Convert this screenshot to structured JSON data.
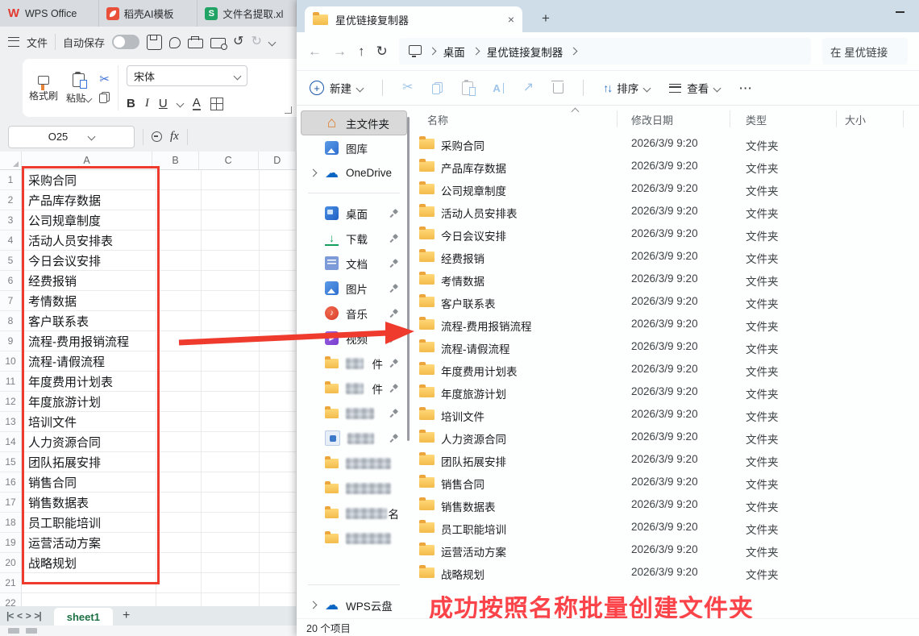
{
  "wps": {
    "tabs": [
      {
        "label": "WPS Office",
        "icon": "tic-wps"
      },
      {
        "label": "稻壳AI模板",
        "icon": "tic-docer"
      },
      {
        "label": "文件名提取.xl",
        "icon": "tic-sheet"
      }
    ],
    "quickbar": {
      "file": "文件",
      "autosave": "自动保存"
    },
    "ribbon": {
      "format_painter": "格式刷",
      "paste": "粘贴",
      "font": "宋体",
      "bold": "B",
      "italic": "I",
      "underline": "U",
      "effect": "A"
    },
    "formula": {
      "name_box": "O25",
      "fx": "fx"
    },
    "grid": {
      "columns": [
        "A",
        "B",
        "C",
        "D"
      ],
      "rows": [
        {
          "n": "1",
          "v": "采购合同"
        },
        {
          "n": "2",
          "v": "产品库存数据"
        },
        {
          "n": "3",
          "v": "公司规章制度"
        },
        {
          "n": "4",
          "v": "活动人员安排表"
        },
        {
          "n": "5",
          "v": "今日会议安排"
        },
        {
          "n": "6",
          "v": "经费报销"
        },
        {
          "n": "7",
          "v": "考情数据"
        },
        {
          "n": "8",
          "v": "客户联系表"
        },
        {
          "n": "9",
          "v": "流程-费用报销流程"
        },
        {
          "n": "10",
          "v": "流程-请假流程"
        },
        {
          "n": "11",
          "v": "年度费用计划表"
        },
        {
          "n": "12",
          "v": "年度旅游计划"
        },
        {
          "n": "13",
          "v": "培训文件"
        },
        {
          "n": "14",
          "v": "人力资源合同"
        },
        {
          "n": "15",
          "v": "团队拓展安排"
        },
        {
          "n": "16",
          "v": "销售合同"
        },
        {
          "n": "17",
          "v": "销售数据表"
        },
        {
          "n": "18",
          "v": "员工职能培训"
        },
        {
          "n": "19",
          "v": "运营活动方案"
        },
        {
          "n": "20",
          "v": "战略规划"
        },
        {
          "n": "21",
          "v": ""
        },
        {
          "n": "22",
          "v": ""
        }
      ]
    },
    "sheetbar": {
      "tab": "sheet1"
    }
  },
  "explorer": {
    "tab_title": "星优链接复制器",
    "nav": {
      "breadcrumb": [
        "桌面",
        "星优链接复制器"
      ],
      "search": "在 星优链接"
    },
    "commands": {
      "new": "新建",
      "sort": "排序",
      "view": "查看",
      "more": "···"
    },
    "columns": {
      "name": "名称",
      "modified": "修改日期",
      "type": "类型",
      "size": "大小"
    },
    "sidebar": {
      "top": [
        {
          "label": "主文件夹",
          "icon": "ic-home",
          "state": "selected"
        },
        {
          "label": "图库",
          "icon": "ic-gallery"
        },
        {
          "label": "OneDrive",
          "icon": "ic-onedrive",
          "chevron": true
        }
      ],
      "pinned": [
        {
          "label": "桌面",
          "icon": "ic-desktop",
          "pin": true
        },
        {
          "label": "下载",
          "icon": "ic-download",
          "pin": true
        },
        {
          "label": "文档",
          "icon": "ic-doc",
          "pin": true
        },
        {
          "label": "图片",
          "icon": "ic-pic",
          "pin": true
        },
        {
          "label": "音乐",
          "icon": "ic-music",
          "pin": true
        },
        {
          "label": "视频",
          "icon": "ic-video",
          "pin": true
        },
        {
          "label": "",
          "suffix": "件",
          "icon": "ic-folder",
          "pin": true,
          "redacted": true
        },
        {
          "label": "",
          "suffix": "件",
          "icon": "ic-folder",
          "pin": true,
          "redacted": true
        },
        {
          "label": "",
          "suffix": "",
          "icon": "ic-folder",
          "pin": true,
          "redacted": true
        },
        {
          "label": "",
          "suffix": "",
          "icon": "ic-app",
          "pin": true,
          "redacted": true
        }
      ],
      "others": [
        {
          "label": "",
          "suffix": "",
          "icon": "ic-folder",
          "redacted": true
        },
        {
          "label": "",
          "suffix": "",
          "icon": "ic-folder",
          "redacted": true
        },
        {
          "label": "",
          "suffix": "名",
          "icon": "ic-folder",
          "redacted": true
        },
        {
          "label": "",
          "suffix": "",
          "icon": "ic-folder",
          "redacted": true
        }
      ],
      "cloud": {
        "label": "WPS云盘"
      }
    },
    "files": [
      {
        "name": "采购合同",
        "modified": "2026/3/9 9:20",
        "type": "文件夹"
      },
      {
        "name": "产品库存数据",
        "modified": "2026/3/9 9:20",
        "type": "文件夹"
      },
      {
        "name": "公司规章制度",
        "modified": "2026/3/9 9:20",
        "type": "文件夹"
      },
      {
        "name": "活动人员安排表",
        "modified": "2026/3/9 9:20",
        "type": "文件夹"
      },
      {
        "name": "今日会议安排",
        "modified": "2026/3/9 9:20",
        "type": "文件夹"
      },
      {
        "name": "经费报销",
        "modified": "2026/3/9 9:20",
        "type": "文件夹"
      },
      {
        "name": "考情数据",
        "modified": "2026/3/9 9:20",
        "type": "文件夹"
      },
      {
        "name": "客户联系表",
        "modified": "2026/3/9 9:20",
        "type": "文件夹"
      },
      {
        "name": "流程-费用报销流程",
        "modified": "2026/3/9 9:20",
        "type": "文件夹"
      },
      {
        "name": "流程-请假流程",
        "modified": "2026/3/9 9:20",
        "type": "文件夹"
      },
      {
        "name": "年度费用计划表",
        "modified": "2026/3/9 9:20",
        "type": "文件夹"
      },
      {
        "name": "年度旅游计划",
        "modified": "2026/3/9 9:20",
        "type": "文件夹"
      },
      {
        "name": "培训文件",
        "modified": "2026/3/9 9:20",
        "type": "文件夹"
      },
      {
        "name": "人力资源合同",
        "modified": "2026/3/9 9:20",
        "type": "文件夹"
      },
      {
        "name": "团队拓展安排",
        "modified": "2026/3/9 9:20",
        "type": "文件夹"
      },
      {
        "name": "销售合同",
        "modified": "2026/3/9 9:20",
        "type": "文件夹"
      },
      {
        "name": "销售数据表",
        "modified": "2026/3/9 9:20",
        "type": "文件夹"
      },
      {
        "name": "员工职能培训",
        "modified": "2026/3/9 9:20",
        "type": "文件夹"
      },
      {
        "name": "运营活动方案",
        "modified": "2026/3/9 9:20",
        "type": "文件夹"
      },
      {
        "name": "战略规划",
        "modified": "2026/3/9 9:20",
        "type": "文件夹"
      }
    ],
    "status": "20 个项目"
  },
  "annotation": {
    "caption": "成功按照名称批量创建文件夹"
  },
  "colors": {
    "accent_red": "#ee3b2e",
    "caption_red": "#fb4449",
    "folder_yellow": "#f3bb4a",
    "sheet_green": "#1d7044"
  }
}
